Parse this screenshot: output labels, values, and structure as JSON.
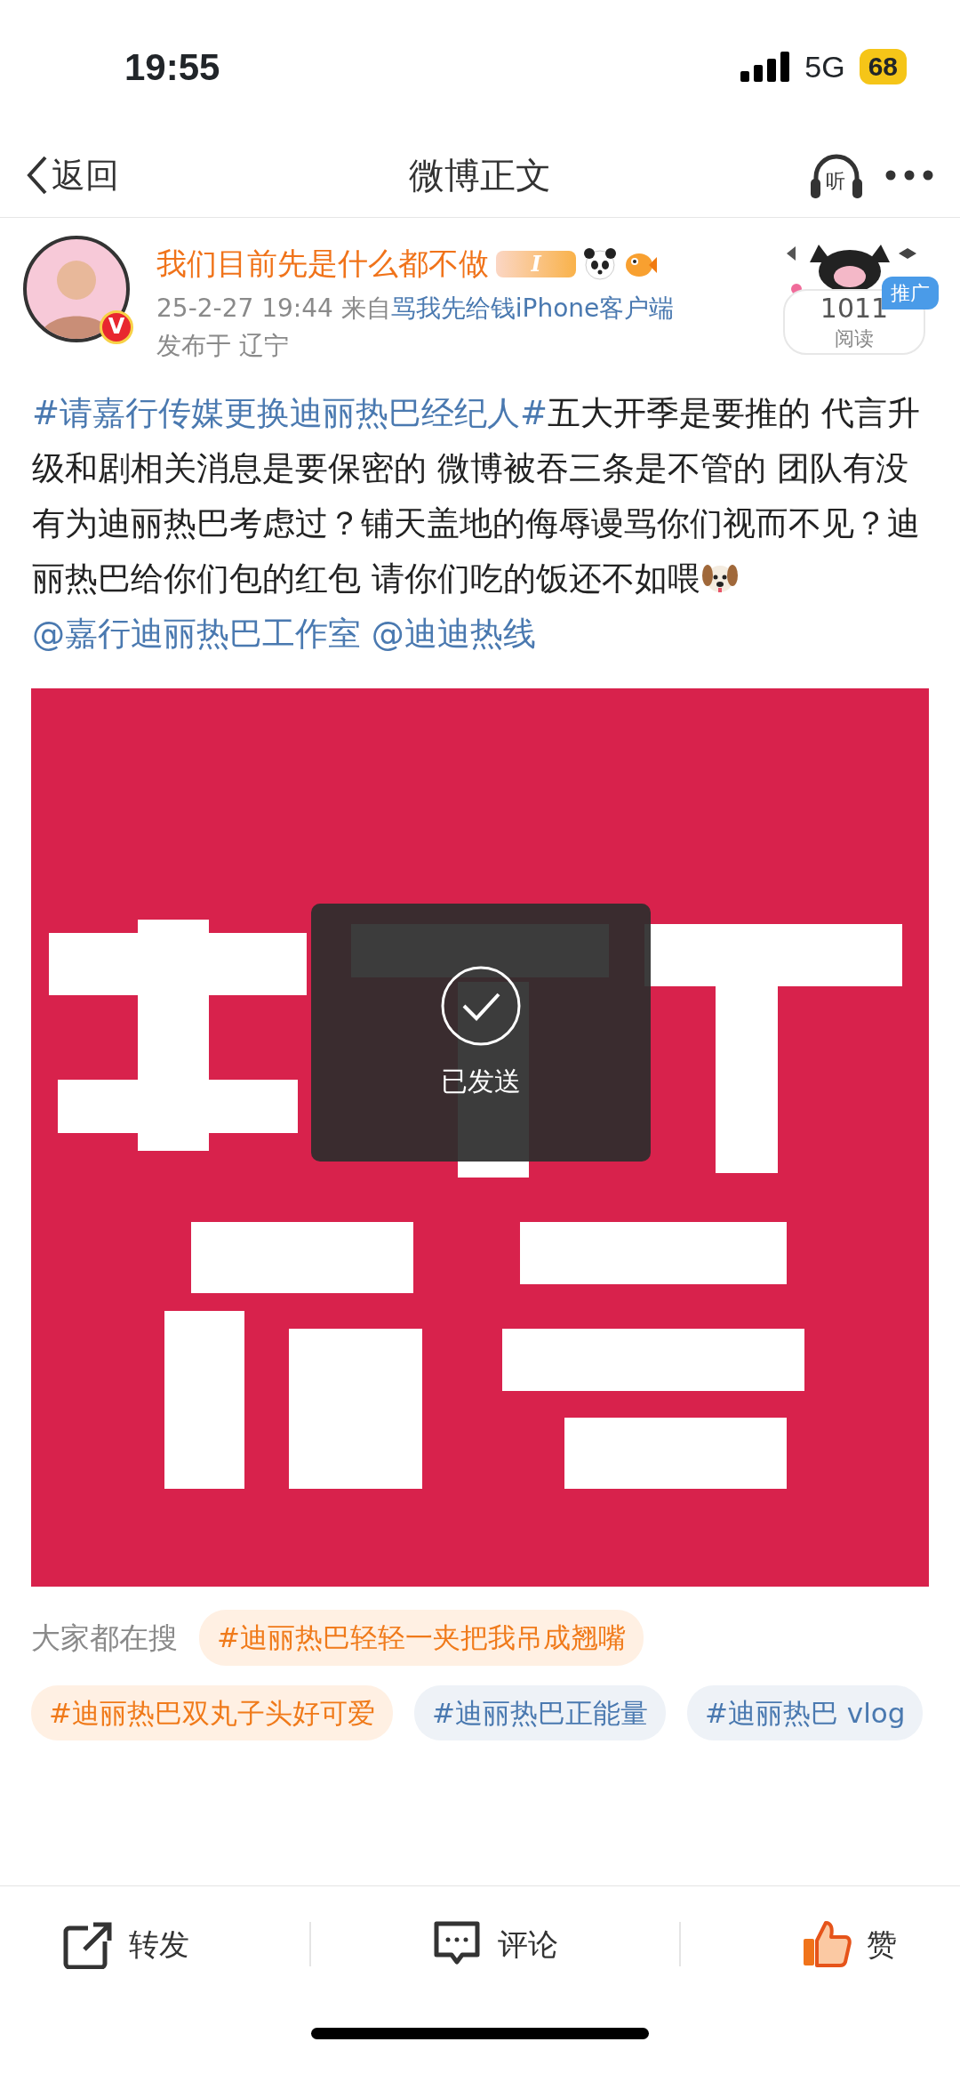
{
  "status_bar": {
    "time": "19:55",
    "network": "5G",
    "battery": "68"
  },
  "nav": {
    "back": "返回",
    "title": "微博正文",
    "listen": "听"
  },
  "post": {
    "username": "我们目前先是什么都不做",
    "verified": "V",
    "badge_letter": "I",
    "time": "25-2-27 19:44",
    "source_prefix": "来自",
    "source": "骂我先给钱iPhone客户端",
    "location": "发布于 辽宁",
    "promo": "推广",
    "reads": "1011",
    "reads_label": "阅读",
    "body": [
      {
        "kind": "topic",
        "text": "#请嘉行传媒更换迪丽热巴经纪人#"
      },
      {
        "kind": "text",
        "text": "五大开季是要推的 代言升级和剧相关消息是要保密的 微博被吞三条是不管的 团队有没有为迪丽热巴考虑过？铺天盖地的侮辱谩骂你们视而不见？迪丽热巴给你们包的红包 请你们吃的饭还不如喂"
      },
      {
        "kind": "emoji"
      },
      {
        "kind": "mention",
        "text": "@嘉行迪丽热巴工作室"
      },
      {
        "kind": "mention",
        "text": "@迪迪热线"
      }
    ],
    "toast": "已发送"
  },
  "trending": {
    "label": "大家都在搜",
    "tags": [
      {
        "text": "#迪丽热巴轻轻一夹把我吊成翘嘴",
        "kind": "hot"
      },
      {
        "text": "#迪丽热巴双丸子头好可爱",
        "kind": "hot"
      },
      {
        "text": "#迪丽热巴正能量",
        "kind": "normal"
      },
      {
        "text": "#迪丽热巴 vlog",
        "kind": "normal"
      }
    ]
  },
  "actions": [
    {
      "kind": "repost",
      "label": "转发"
    },
    {
      "kind": "comment",
      "label": "评论"
    },
    {
      "kind": "like",
      "label": "赞"
    }
  ]
}
